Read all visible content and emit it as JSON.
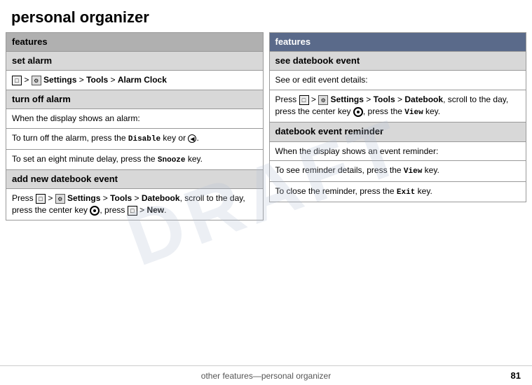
{
  "title": "personal organizer",
  "left_table": {
    "header": "features",
    "sections": [
      {
        "id": "set-alarm",
        "title": "set alarm",
        "rows": [
          {
            "type": "nav",
            "html_key": "set_alarm_nav"
          }
        ]
      },
      {
        "id": "turn-off-alarm",
        "title": "turn off alarm",
        "rows": [
          {
            "text": "When the display shows an alarm:"
          },
          {
            "text": "To turn off the alarm, press the Disable key or .",
            "has_bold": true,
            "bold_word": "Disable"
          },
          {
            "text": "To set an eight minute delay, press the Snooze key.",
            "has_bold": true,
            "bold_word": "Snooze"
          }
        ]
      },
      {
        "id": "add-datebook-event",
        "title": "add new datebook event",
        "rows": [
          {
            "text": "Press  >  Settings > Tools > Datebook, scroll to the day, press the center key , press  > New."
          }
        ]
      }
    ]
  },
  "right_table": {
    "header": "features",
    "sections": [
      {
        "id": "see-datebook-event",
        "title": "see datebook event",
        "rows": [
          {
            "text": "See or edit event details:"
          },
          {
            "text": "Press  >  Settings > Tools > Datebook, scroll to the day, press the center key , press the View key.",
            "has_bold": true,
            "bold_word": "View"
          }
        ]
      },
      {
        "id": "datebook-event-reminder",
        "title": "datebook event reminder",
        "rows": [
          {
            "text": "When the display shows an event reminder:"
          },
          {
            "text": "To see reminder details, press the View key.",
            "has_bold": true,
            "bold_word": "View"
          },
          {
            "text": "To close the reminder, press the Exit key.",
            "has_bold": true,
            "bold_word": "Exit"
          }
        ]
      }
    ]
  },
  "footer": {
    "center_text": "other features—personal organizer",
    "page_number": "81"
  },
  "watermark": "DRAFT"
}
